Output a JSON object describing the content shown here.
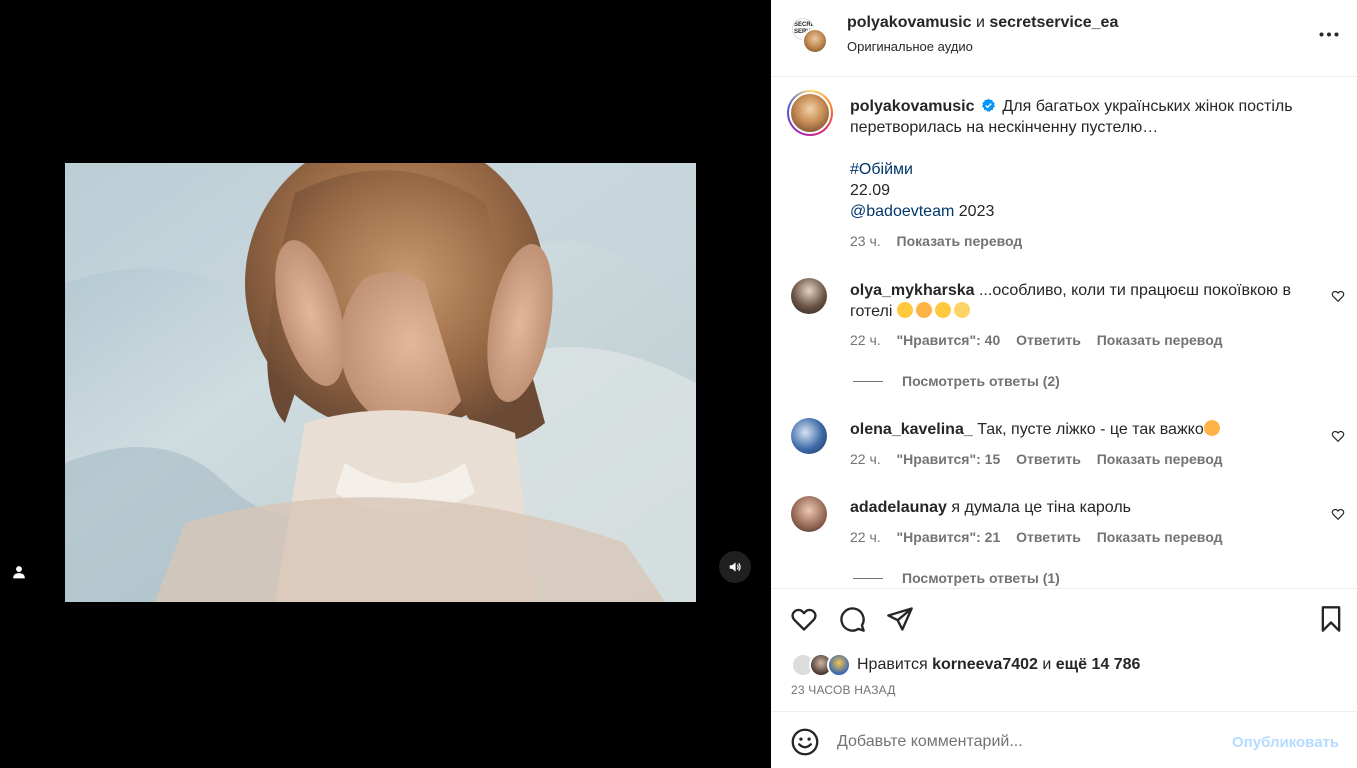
{
  "header": {
    "author": "polyakovamusic",
    "and_text": "и",
    "coauthor": "secretservice_ea",
    "subtitle": "Оригинальное аудио",
    "avatar_text": "SECRET SERVICE"
  },
  "caption": {
    "username": "polyakovamusic",
    "text": "Для багатьох українських жінок постіль перетворилась на нескінченну пустелю…",
    "hashtag": "#Обійми",
    "date_line": "22.09",
    "mention": "@badoevteam",
    "year": "2023",
    "time": "23 ч.",
    "translate": "Показать перевод"
  },
  "comments": [
    {
      "username": "olya_mykharska",
      "text": "...особливо, коли ти працюєш покоївкою в готелі",
      "emojis": [
        "😅",
        "🤗",
        "🫣",
        "😕"
      ],
      "time": "22 ч.",
      "likes": "\"Нравится\": 40",
      "reply": "Ответить",
      "translate": "Показать перевод",
      "view_replies": "Посмотреть ответы (2)"
    },
    {
      "username": "olena_kavelina_",
      "text": "Так, пусте ліжко - це так важко",
      "emojis": [
        "😳"
      ],
      "time": "22 ч.",
      "likes": "\"Нравится\": 15",
      "reply": "Ответить",
      "translate": "Показать перевод"
    },
    {
      "username": "adadelaunay",
      "text": "я думала це тіна кароль",
      "time": "22 ч.",
      "likes": "\"Нравится\": 21",
      "reply": "Ответить",
      "translate": "Показать перевод",
      "view_replies": "Посмотреть ответы (1)"
    }
  ],
  "likes": {
    "prefix": "Нравится",
    "user": "korneeva7402",
    "conj": "и",
    "others": "ещё 14 786",
    "time_ago": "23 ЧАСОВ НАЗАД"
  },
  "add_comment": {
    "placeholder": "Добавьте комментарий...",
    "publish": "Опубликовать"
  },
  "icons": {
    "like": "heart-icon",
    "comment": "comment-icon",
    "share": "paper-plane-icon",
    "save": "bookmark-icon",
    "emoji": "smiley-icon",
    "more": "more-dots-icon",
    "tags": "person-icon",
    "audio": "speaker-icon",
    "verified": "verified-badge-icon"
  },
  "colors": {
    "link": "#00376b",
    "muted": "#737373",
    "publish_disabled": "#b3dbff",
    "verified": "#0095f6"
  }
}
